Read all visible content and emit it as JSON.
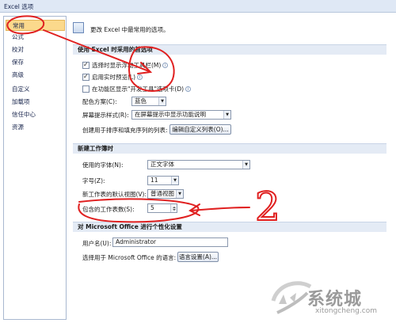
{
  "window": {
    "title": "Excel 选项"
  },
  "sidebar": {
    "items": [
      {
        "label": "常用",
        "selected": true
      },
      {
        "label": "公式"
      },
      {
        "label": "校对"
      },
      {
        "label": "保存"
      },
      {
        "label": "高级"
      },
      {
        "label": "自定义"
      },
      {
        "label": "加载项"
      },
      {
        "label": "信任中心"
      },
      {
        "label": "资源"
      }
    ]
  },
  "banner": {
    "text": "更改 Excel 中最常用的选项。"
  },
  "section1": {
    "header": "使用 Excel 时采用的首选项",
    "opt_minitoolbar": "选择时显示浮动工具栏(M)",
    "opt_livepreview": "启用实时预览(L)",
    "opt_devtab": "在功能区显示\"开发工具\"选项卡(D)",
    "color_label": "配色方案(C):",
    "color_value": "蓝色",
    "tooltip_label": "屏幕提示样式(R):",
    "tooltip_value": "在屏幕提示中显示功能说明",
    "sortlist_label": "创建用于排序和填充序列的列表:",
    "sortlist_button": "编辑自定义列表(O)..."
  },
  "section2": {
    "header": "新建工作簿时",
    "font_label": "使用的字体(N):",
    "font_value": "正文字体",
    "size_label": "字号(Z):",
    "size_value": "11",
    "view_label": "新工作表的默认视图(V):",
    "view_value": "普通视图",
    "sheets_label": "包含的工作表数(S):",
    "sheets_value": "5"
  },
  "section3": {
    "header": "对 Microsoft Office 进行个性化设置",
    "username_label": "用户名(U):",
    "username_value": "Administrator",
    "language_label": "选择用于 Microsoft Office 的语言:",
    "language_button": "语言设置(A)..."
  },
  "annotation": {
    "number": "2",
    "color": "#e02020"
  },
  "watermark": {
    "text": "系统城",
    "url": "xitongcheng.com"
  },
  "colors": {
    "accent": "#fbd98c",
    "section_bg": "#e4ebf5"
  }
}
